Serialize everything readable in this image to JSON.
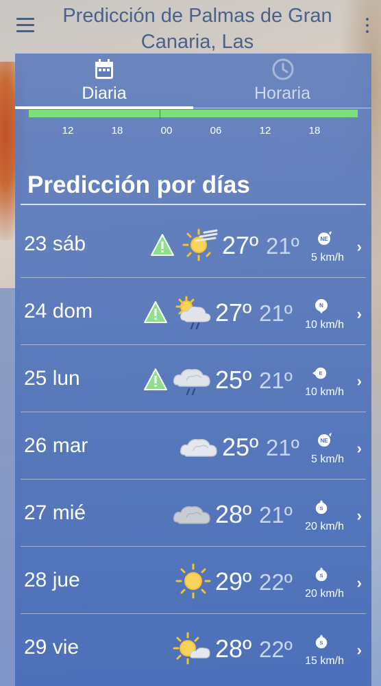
{
  "header": {
    "title": "Predicción de Palmas de Gran Canaria, Las"
  },
  "tabs": [
    {
      "label": "Diaria",
      "icon": "calendar-icon",
      "active": true
    },
    {
      "label": "Horaria",
      "icon": "clock-icon",
      "active": false
    }
  ],
  "timeline": {
    "ticks": [
      "12",
      "18",
      "00",
      "06",
      "12",
      "18"
    ],
    "bar_color": "#7ee07a"
  },
  "section": {
    "title": "Predicción por días"
  },
  "days": [
    {
      "label": "23 sáb",
      "warning": true,
      "icon": "sun-haze-icon",
      "tmax": "27º",
      "tmin": "21º",
      "wind_dir": "NE",
      "wind_speed": "5 km/h"
    },
    {
      "label": "24 dom",
      "warning": true,
      "icon": "sun-cloud-rain-icon",
      "tmax": "27º",
      "tmin": "21º",
      "wind_dir": "N",
      "wind_speed": "10 km/h"
    },
    {
      "label": "25 lun",
      "warning": true,
      "icon": "cloud-rain-icon",
      "tmax": "25º",
      "tmin": "21º",
      "wind_dir": "E",
      "wind_speed": "10 km/h"
    },
    {
      "label": "26 mar",
      "warning": false,
      "icon": "cloud-icon",
      "tmax": "25º",
      "tmin": "21º",
      "wind_dir": "NE",
      "wind_speed": "5 km/h"
    },
    {
      "label": "27 mié",
      "warning": false,
      "icon": "cloud-gray-icon",
      "tmax": "28º",
      "tmin": "21º",
      "wind_dir": "S",
      "wind_speed": "20 km/h"
    },
    {
      "label": "28 jue",
      "warning": false,
      "icon": "sun-icon",
      "tmax": "29º",
      "tmin": "22º",
      "wind_dir": "S",
      "wind_speed": "20 km/h"
    },
    {
      "label": "29 vie",
      "warning": false,
      "icon": "sun-small-cloud-icon",
      "tmax": "28º",
      "tmin": "22º",
      "wind_dir": "S",
      "wind_speed": "15 km/h"
    }
  ],
  "colors": {
    "accent": "#7ee07a",
    "warning": "#8ee08c",
    "panel": "#5676bb",
    "sun": "#f6c331"
  }
}
